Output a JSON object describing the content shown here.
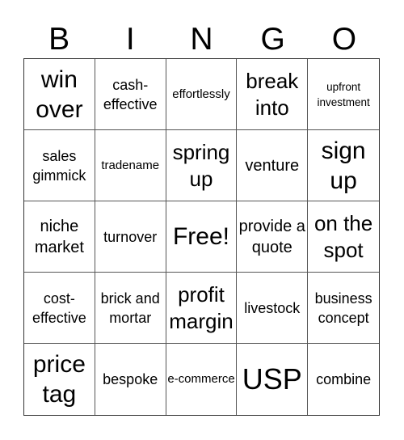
{
  "header": {
    "letters": [
      "B",
      "I",
      "N",
      "G",
      "O"
    ]
  },
  "card": {
    "free_label": "Free!",
    "cells": [
      {
        "text": "win over",
        "size": "s-xl"
      },
      {
        "text": "cash-effective",
        "size": "s-sm"
      },
      {
        "text": "effortlessly",
        "size": "s-xs"
      },
      {
        "text": "break into",
        "size": "s-lg"
      },
      {
        "text": "upfront investment",
        "size": "s-xxs"
      },
      {
        "text": "sales gimmick",
        "size": "s-sm"
      },
      {
        "text": "tradename",
        "size": "s-xs"
      },
      {
        "text": "spring up",
        "size": "s-lg"
      },
      {
        "text": "venture",
        "size": "s-md"
      },
      {
        "text": "sign up",
        "size": "s-xl"
      },
      {
        "text": "niche market",
        "size": "s-md"
      },
      {
        "text": "turnover",
        "size": "s-sm"
      },
      {
        "text": "Free!",
        "size": "s-free"
      },
      {
        "text": "provide a quote",
        "size": "s-md"
      },
      {
        "text": "on the spot",
        "size": "s-lg"
      },
      {
        "text": "cost-effective",
        "size": "s-sm"
      },
      {
        "text": "brick and mortar",
        "size": "s-sm"
      },
      {
        "text": "profit margin",
        "size": "s-lg"
      },
      {
        "text": "livestock",
        "size": "s-sm"
      },
      {
        "text": "business concept",
        "size": "s-sm"
      },
      {
        "text": "price tag",
        "size": "s-xl"
      },
      {
        "text": "bespoke",
        "size": "s-sm"
      },
      {
        "text": "e-commerce",
        "size": "s-xs"
      },
      {
        "text": "USP",
        "size": "s-usp"
      },
      {
        "text": "combine",
        "size": "s-sm"
      }
    ]
  }
}
